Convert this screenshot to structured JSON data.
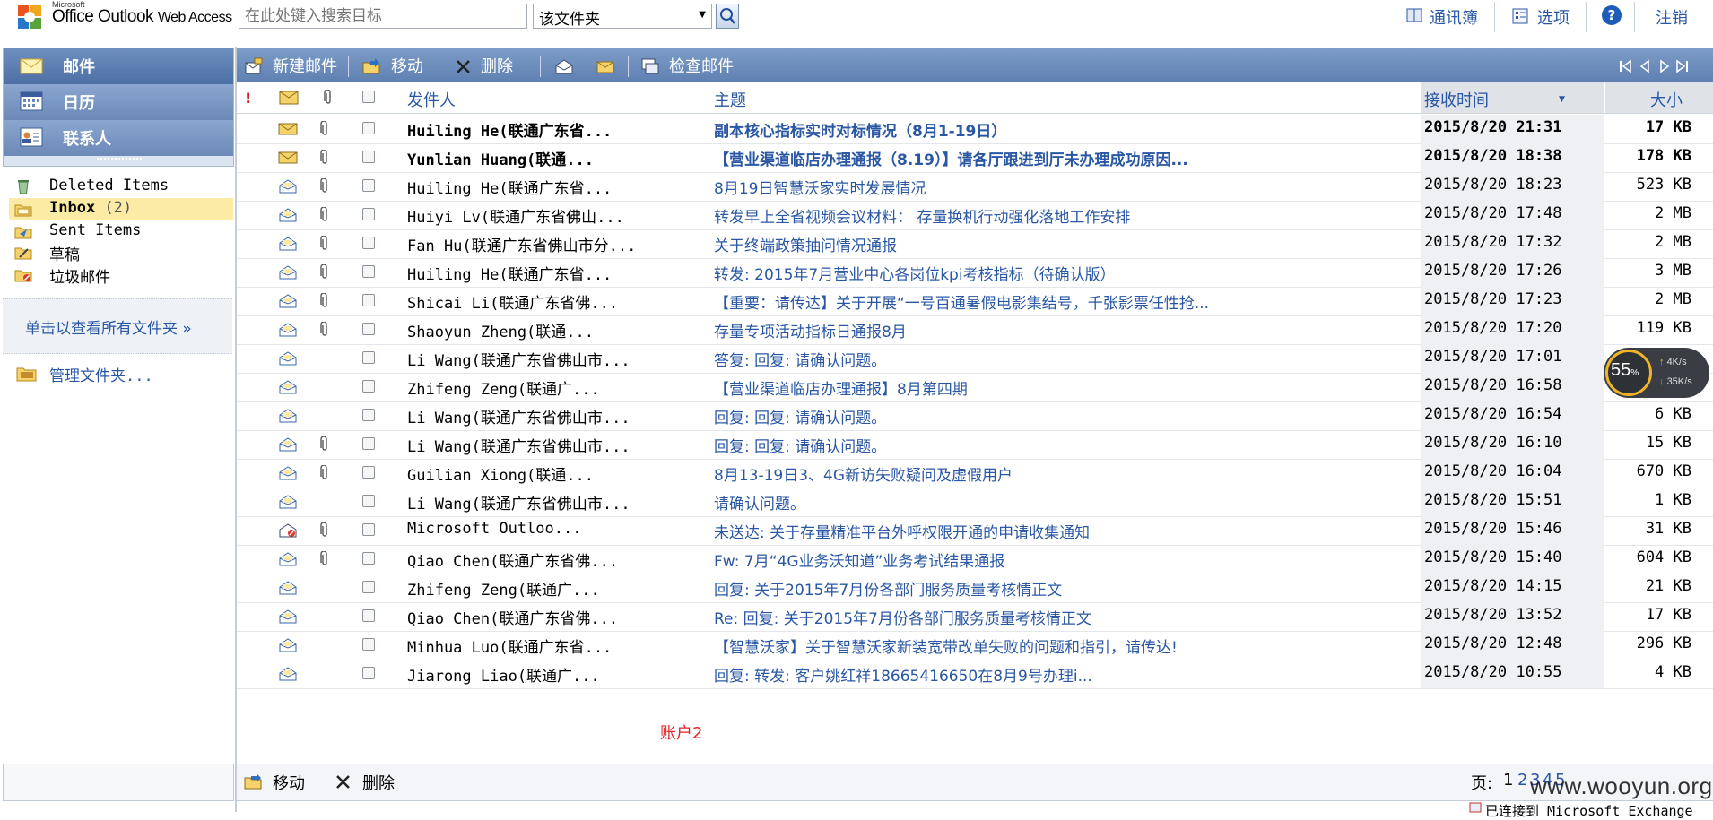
{
  "app": {
    "brand_small": "Microsoft",
    "brand_main": "Office Outlook",
    "brand_suffix": "Web Access"
  },
  "search": {
    "placeholder": "在此处键入搜索目标",
    "scope": "该文件夹"
  },
  "top_links": {
    "address_book": "通讯簿",
    "options": "选项",
    "help": "?",
    "logout": "注销"
  },
  "nav": {
    "mail": "邮件",
    "calendar": "日历",
    "contacts": "联系人"
  },
  "folders": [
    {
      "label": "Deleted Items",
      "icon": "deleted-items-icon"
    },
    {
      "label": "Inbox",
      "count": "(2)",
      "icon": "inbox-icon"
    },
    {
      "label": "Sent Items",
      "icon": "sent-items-icon"
    },
    {
      "label": "草稿",
      "icon": "drafts-icon"
    },
    {
      "label": "垃圾邮件",
      "icon": "junk-icon"
    }
  ],
  "show_all_folders": "单击以查看所有文件夹 »",
  "manage_folders": "管理文件夹...",
  "toolbar": {
    "new_mail": "新建邮件",
    "move": "移动",
    "delete": "删除",
    "check_mail": "检查邮件"
  },
  "columns": {
    "from": "发件人",
    "subject": "主题",
    "received": "接收时间",
    "size": "大小"
  },
  "messages": [
    {
      "from": "Huiling He(联通广东省...",
      "subject": "副本核心指标实时对标情况（8月1-19日）",
      "time": "2015/8/20  21:31",
      "size": "17 KB",
      "unread": true,
      "attach": true
    },
    {
      "from": "Yunlian Huang(联通...",
      "subject": "【营业渠道临店办理通报（8.19）】请各厅跟进到厅未办理成功原因...",
      "time": "2015/8/20  18:38",
      "size": "178 KB",
      "unread": true,
      "attach": true
    },
    {
      "from": "Huiling He(联通广东省...",
      "subject": "8月19日智慧沃家实时发展情况",
      "time": "2015/8/20  18:23",
      "size": "523 KB",
      "unread": false,
      "attach": true
    },
    {
      "from": "Huiyi Lv(联通广东省佛山...",
      "subject": "转发早上全省视频会议材料： 存量换机行动强化落地工作安排",
      "time": "2015/8/20  17:48",
      "size": "2 MB",
      "unread": false,
      "attach": true
    },
    {
      "from": "Fan Hu(联通广东省佛山市分...",
      "subject": "关于终端政策抽问情况通报",
      "time": "2015/8/20  17:32",
      "size": "2 MB",
      "unread": false,
      "attach": true
    },
    {
      "from": "Huiling He(联通广东省...",
      "subject": "转发: 2015年7月营业中心各岗位kpi考核指标（待确认版）",
      "time": "2015/8/20  17:26",
      "size": "3 MB",
      "unread": false,
      "attach": true
    },
    {
      "from": "Shicai Li(联通广东省佛...",
      "subject": "【重要：请传达】关于开展“一号百通暑假电影集结号，千张影票任性抢...",
      "time": "2015/8/20  17:23",
      "size": "2 MB",
      "unread": false,
      "attach": true
    },
    {
      "from": "Shaoyun Zheng(联通...",
      "subject": "存量专项活动指标日通报8月",
      "time": "2015/8/20  17:20",
      "size": "119 KB",
      "unread": false,
      "attach": true
    },
    {
      "from": "Li Wang(联通广东省佛山市...",
      "subject": "答复: 回复: 请确认问题。",
      "time": "2015/8/20  17:01",
      "size": "",
      "unread": false,
      "attach": false
    },
    {
      "from": "Zhifeng Zeng(联通广...",
      "subject": "【营业渠道临店办理通报】8月第四期",
      "time": "2015/8/20  16:58",
      "size": "",
      "unread": false,
      "attach": false
    },
    {
      "from": "Li Wang(联通广东省佛山市...",
      "subject": "回复: 回复: 请确认问题。",
      "time": "2015/8/20  16:54",
      "size": "6 KB",
      "unread": false,
      "attach": false
    },
    {
      "from": "Li Wang(联通广东省佛山市...",
      "subject": "回复: 回复: 请确认问题。",
      "time": "2015/8/20  16:10",
      "size": "15 KB",
      "unread": false,
      "attach": true
    },
    {
      "from": "Guilian Xiong(联通...",
      "subject": "8月13-19日3、4G新访失败疑问及虚假用户",
      "time": "2015/8/20  16:04",
      "size": "670 KB",
      "unread": false,
      "attach": true
    },
    {
      "from": "Li Wang(联通广东省佛山市...",
      "subject": "请确认问题。",
      "time": "2015/8/20  15:51",
      "size": "1 KB",
      "unread": false,
      "attach": false
    },
    {
      "from": "Microsoft Outloo...",
      "subject": "未送达: 关于存量精准平台外呼权限开通的申请收集通知",
      "time": "2015/8/20  15:46",
      "size": "31 KB",
      "unread": false,
      "attach": true,
      "ndr": true
    },
    {
      "from": "Qiao Chen(联通广东省佛...",
      "subject": "Fw: 7月“4G业务沃知道”业务考试结果通报",
      "time": "2015/8/20  15:40",
      "size": "604 KB",
      "unread": false,
      "attach": true
    },
    {
      "from": "Zhifeng Zeng(联通广...",
      "subject": "回复: 关于2015年7月份各部门服务质量考核情正文",
      "time": "2015/8/20  14:15",
      "size": "21 KB",
      "unread": false,
      "attach": false
    },
    {
      "from": "Qiao Chen(联通广东省佛...",
      "subject": "Re: 回复: 关于2015年7月份各部门服务质量考核情正文",
      "time": "2015/8/20  13:52",
      "size": "17 KB",
      "unread": false,
      "attach": false
    },
    {
      "from": "Minhua Luo(联通广东省...",
      "subject": "【智慧沃家】关于智慧沃家新装宽带改单失败的问题和指引，请传达!",
      "time": "2015/8/20  12:48",
      "size": "296 KB",
      "unread": false,
      "attach": false
    },
    {
      "from": "Jiarong Liao(联通广...",
      "subject": "回复: 转发: 客户姚红祥18665416650在8月9号办理i...",
      "time": "2015/8/20  10:55",
      "size": "4 KB",
      "unread": false,
      "attach": false
    }
  ],
  "account_note": "账户2",
  "bottom": {
    "move": "移动",
    "delete": "删除",
    "page_label": "页:",
    "pages": [
      "1",
      "2",
      "3",
      "4",
      "5"
    ],
    "status": "已连接到 Microsoft Exchange"
  },
  "speed_widget": {
    "percent": "55",
    "percent_unit": "%",
    "up": "4K/s",
    "down": "35K/s"
  },
  "watermark": "www.wooyun.org"
}
